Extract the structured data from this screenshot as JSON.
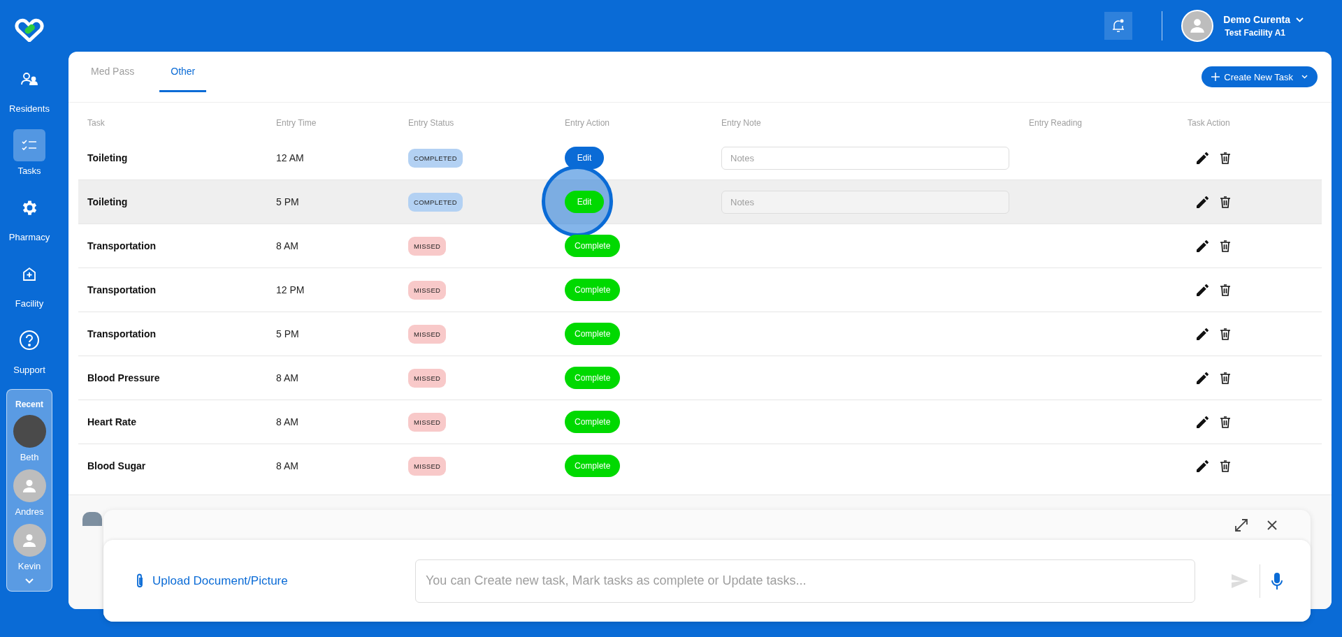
{
  "sidebar": {
    "items": [
      {
        "label": "Residents",
        "selected": false
      },
      {
        "label": "Tasks",
        "selected": true
      },
      {
        "label": "Pharmacy",
        "selected": false
      },
      {
        "label": "Facility",
        "selected": false
      },
      {
        "label": "Support",
        "selected": false
      }
    ],
    "recent": {
      "title": "Recent",
      "people": [
        {
          "name": "Beth",
          "kind": "photo"
        },
        {
          "name": "Andres",
          "kind": "silhouette"
        },
        {
          "name": "Kevin",
          "kind": "silhouette"
        }
      ]
    }
  },
  "header": {
    "user_name": "Demo Curenta",
    "facility": "Test Facility A1"
  },
  "tabs": [
    {
      "label": "Med Pass",
      "selected": false
    },
    {
      "label": "Other",
      "selected": true
    }
  ],
  "create_button": "Create New Task",
  "table": {
    "columns": [
      "Task",
      "Entry Time",
      "Entry Status",
      "Entry Action",
      "Entry Note",
      "Entry Reading",
      "Task Action"
    ],
    "rows": [
      {
        "task": "Toileting",
        "time": "12 AM",
        "status": {
          "label": "COMPLETED",
          "kind": "completed"
        },
        "action": {
          "label": "Edit",
          "kind": "primary",
          "highlighted": false
        },
        "note": {
          "placeholder": "Notes"
        },
        "selected": false
      },
      {
        "task": "Toileting",
        "time": "5 PM",
        "status": {
          "label": "COMPLETED",
          "kind": "completed"
        },
        "action": {
          "label": "Edit",
          "kind": "success",
          "highlighted": true
        },
        "note": {
          "placeholder": "Notes"
        },
        "selected": true
      },
      {
        "task": "Transportation",
        "time": "8 AM",
        "status": {
          "label": "MISSED",
          "kind": "missed"
        },
        "action": {
          "label": "Complete",
          "kind": "success",
          "highlighted": false
        },
        "selected": false
      },
      {
        "task": "Transportation",
        "time": "12 PM",
        "status": {
          "label": "MISSED",
          "kind": "missed"
        },
        "action": {
          "label": "Complete",
          "kind": "success",
          "highlighted": false
        },
        "selected": false
      },
      {
        "task": "Transportation",
        "time": "5 PM",
        "status": {
          "label": "MISSED",
          "kind": "missed"
        },
        "action": {
          "label": "Complete",
          "kind": "success",
          "highlighted": false
        },
        "selected": false
      },
      {
        "task": "Blood Pressure",
        "time": "8 AM",
        "status": {
          "label": "MISSED",
          "kind": "missed"
        },
        "action": {
          "label": "Complete",
          "kind": "success",
          "highlighted": false
        },
        "selected": false
      },
      {
        "task": "Heart Rate",
        "time": "8 AM",
        "status": {
          "label": "MISSED",
          "kind": "missed"
        },
        "action": {
          "label": "Complete",
          "kind": "success",
          "highlighted": false
        },
        "selected": false
      },
      {
        "task": "Blood Sugar",
        "time": "8 AM",
        "status": {
          "label": "MISSED",
          "kind": "missed"
        },
        "action": {
          "label": "Complete",
          "kind": "success",
          "highlighted": false
        },
        "selected": false
      }
    ]
  },
  "chat": {
    "upload_label": "Upload Document/Picture",
    "placeholder": "You can Create new task, Mark tasks as complete or Update tasks..."
  }
}
